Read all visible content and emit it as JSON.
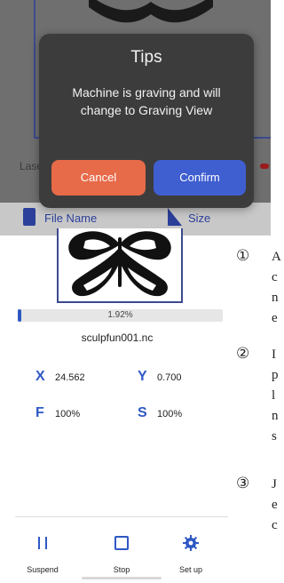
{
  "background_screen": {
    "laser_label": "Lase",
    "file_name_label": "File Name",
    "size_label": "Size"
  },
  "modal": {
    "title": "Tips",
    "message": "Machine is graving and will change to Graving View",
    "cancel_label": "Cancel",
    "confirm_label": "Confirm"
  },
  "notes": [
    {
      "num": "①",
      "lines": [
        "A",
        "c",
        "n",
        "e"
      ]
    },
    {
      "num": "②",
      "lines": [
        "I",
        "p",
        "l",
        "n",
        "s"
      ]
    },
    {
      "num": "③",
      "lines": [
        "J",
        "e",
        "c"
      ]
    }
  ],
  "engraving": {
    "progress_text": "1.92%",
    "progress_value": 1.92,
    "file_name": "sculpfun001.nc",
    "x_label": "X",
    "x_value": "24.562",
    "y_label": "Y",
    "y_value": "0.700",
    "f_label": "F",
    "f_value": "100%",
    "s_label": "S",
    "s_value": "100%"
  },
  "toolbar": {
    "suspend_label": "Suspend",
    "stop_label": "Stop",
    "setup_label": "Set up"
  },
  "colors": {
    "accent": "#2f58c5",
    "cancel": "#e76a49",
    "confirm": "#3f5fd0",
    "modal_bg": "#3c3c3c"
  },
  "icons": {
    "suspend": "pause-icon",
    "stop": "stop-icon",
    "setup": "gear-icon",
    "file": "file-icon",
    "size": "ruler-icon"
  }
}
